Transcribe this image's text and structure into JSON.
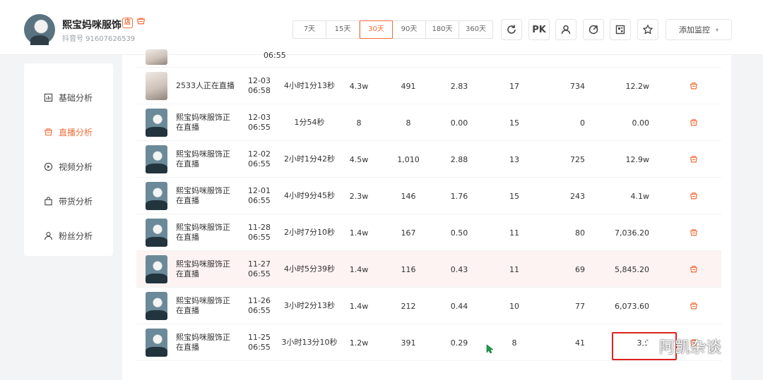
{
  "profile": {
    "name": "熙宝妈咪服饰",
    "douyin_id": "抖音号 91607626539",
    "shop_badge": "店"
  },
  "time_ranges": [
    {
      "label": "7天",
      "active": false
    },
    {
      "label": "15天",
      "active": false
    },
    {
      "label": "30天",
      "active": true
    },
    {
      "label": "90天",
      "active": false
    },
    {
      "label": "180天",
      "active": false
    },
    {
      "label": "360天",
      "active": false
    }
  ],
  "toolbar": {
    "pk_label": "PK",
    "add_monitor": "添加监控"
  },
  "sidebar": {
    "items": [
      {
        "label": "基础分析",
        "icon": "bar-chart-icon",
        "active": false
      },
      {
        "label": "直播分析",
        "icon": "live-cart-icon",
        "active": true
      },
      {
        "label": "视频分析",
        "icon": "play-icon",
        "active": false
      },
      {
        "label": "带货分析",
        "icon": "bag-icon",
        "active": false
      },
      {
        "label": "粉丝分析",
        "icon": "user-icon",
        "active": false
      }
    ]
  },
  "top_partial_row": {
    "time": "06:55"
  },
  "rows": [
    {
      "thumb": "light",
      "title": [
        "2533人正在直播"
      ],
      "date": "12-03",
      "time": "06:58",
      "duration": "4小时1分13秒",
      "v1": "4.3w",
      "v2": "491",
      "v3": "2.83",
      "v4": "17",
      "v5": "734",
      "v6": "12.2w",
      "highlight": false
    },
    {
      "thumb": "dark",
      "title": [
        "熙宝妈咪服饰正",
        "在直播"
      ],
      "date": "12-03",
      "time": "06:55",
      "duration": "1分54秒",
      "v1": "8",
      "v2": "8",
      "v3": "0.00",
      "v4": "15",
      "v5": "0",
      "v6": "0.00",
      "highlight": false
    },
    {
      "thumb": "dark",
      "title": [
        "熙宝妈咪服饰正",
        "在直播"
      ],
      "date": "12-02",
      "time": "06:55",
      "duration": "2小时1分42秒",
      "v1": "4.5w",
      "v2": "1,010",
      "v3": "2.88",
      "v4": "13",
      "v5": "725",
      "v6": "12.9w",
      "highlight": false
    },
    {
      "thumb": "dark",
      "title": [
        "熙宝妈咪服饰正",
        "在直播"
      ],
      "date": "12-01",
      "time": "06:55",
      "duration": "4小时9分45秒",
      "v1": "2.3w",
      "v2": "146",
      "v3": "1.76",
      "v4": "15",
      "v5": "243",
      "v6": "4.1w",
      "highlight": false
    },
    {
      "thumb": "dark",
      "title": [
        "熙宝妈咪服饰正",
        "在直播"
      ],
      "date": "11-28",
      "time": "06:55",
      "duration": "2小时7分10秒",
      "v1": "1.4w",
      "v2": "167",
      "v3": "0.50",
      "v4": "11",
      "v5": "80",
      "v6": "7,036.20",
      "highlight": false
    },
    {
      "thumb": "dark",
      "title": [
        "熙宝妈咪服饰正",
        "在直播"
      ],
      "date": "11-27",
      "time": "06:55",
      "duration": "4小时5分39秒",
      "v1": "1.4w",
      "v2": "116",
      "v3": "0.43",
      "v4": "11",
      "v5": "69",
      "v6": "5,845.20",
      "highlight": true
    },
    {
      "thumb": "dark",
      "title": [
        "熙宝妈咪服饰正",
        "在直播"
      ],
      "date": "11-26",
      "time": "06:55",
      "duration": "3小时2分13秒",
      "v1": "1.4w",
      "v2": "212",
      "v3": "0.44",
      "v4": "10",
      "v5": "77",
      "v6": "6,073.60",
      "highlight": false
    },
    {
      "thumb": "dark",
      "title": [
        "熙宝妈咪服饰正",
        "在直播"
      ],
      "date": "11-25",
      "time": "06:55",
      "duration": "3小时13分10秒",
      "v1": "1.2w",
      "v2": "391",
      "v3": "0.29",
      "v4": "8",
      "v5": "41",
      "v6": "3,5",
      "highlight": false
    }
  ],
  "watermark": {
    "text": "阿凯杂谈"
  },
  "colors": {
    "accent": "#f06f3a",
    "highlight_row": "#fdf3f2",
    "red_box": "#e02020"
  }
}
